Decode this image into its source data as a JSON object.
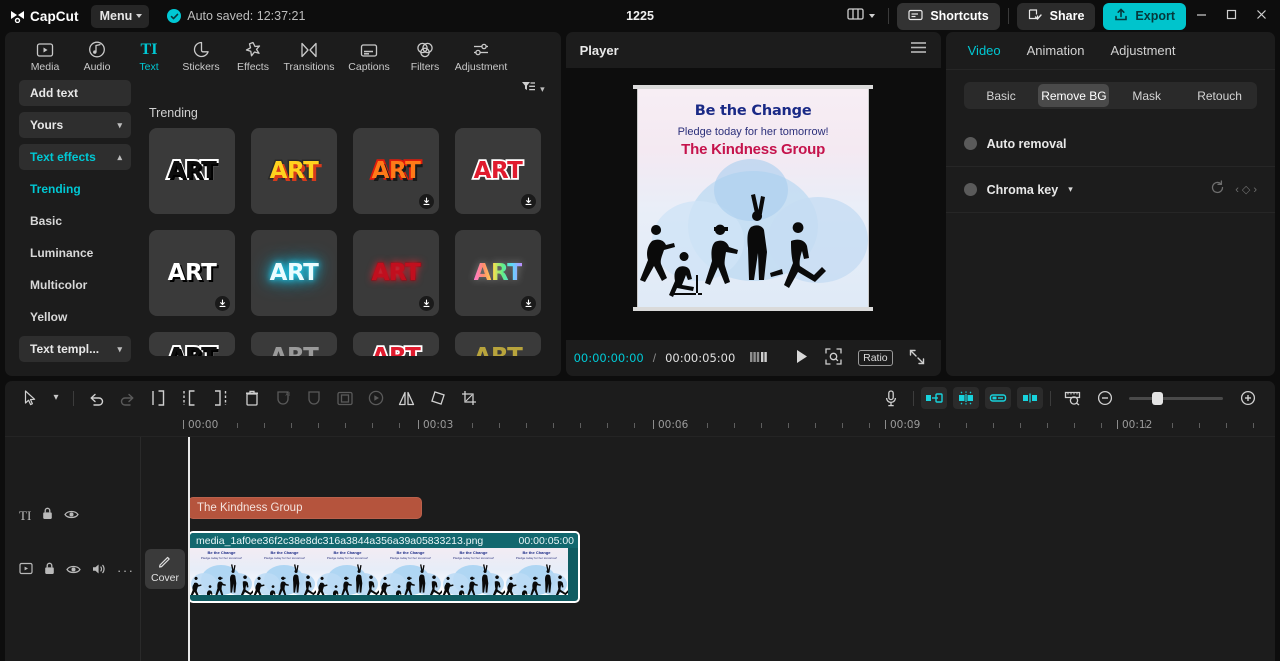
{
  "titlebar": {
    "brand": "CapCut",
    "menu_label": "Menu",
    "autosave_text": "Auto saved: 12:37:21",
    "project_title": "1225",
    "layout_icon": "layout-icon",
    "shortcuts_label": "Shortcuts",
    "share_label": "Share",
    "export_label": "Export",
    "minimize_icon": "minimize-icon",
    "maximize_icon": "maximize-icon",
    "close_icon": "close-icon",
    "accent": "#00c4cc"
  },
  "tabs": [
    {
      "label": "Media",
      "icon": "media-icon",
      "active": false
    },
    {
      "label": "Audio",
      "icon": "audio-icon",
      "active": false
    },
    {
      "label": "Text",
      "icon": "text-icon",
      "active": true
    },
    {
      "label": "Stickers",
      "icon": "stickers-icon",
      "active": false
    },
    {
      "label": "Effects",
      "icon": "effects-icon",
      "active": false
    },
    {
      "label": "Transitions",
      "icon": "transitions-icon",
      "active": false
    },
    {
      "label": "Captions",
      "icon": "captions-icon",
      "active": false
    },
    {
      "label": "Filters",
      "icon": "filters-icon",
      "active": false
    },
    {
      "label": "Adjustment",
      "icon": "adjustment-icon",
      "active": false
    }
  ],
  "sidebar": {
    "add_text": "Add text",
    "yours": "Yours",
    "text_effects": "Text effects",
    "sub_items": [
      {
        "label": "Trending",
        "selected": true
      },
      {
        "label": "Basic",
        "selected": false
      },
      {
        "label": "Luminance",
        "selected": false
      },
      {
        "label": "Multicolor",
        "selected": false
      },
      {
        "label": "Yellow",
        "selected": false
      }
    ],
    "text_templates": "Text templ..."
  },
  "effects_panel": {
    "filter_icon": "filter-sort-icon",
    "section_title": "Trending",
    "thumbs": [
      {
        "label": "ART",
        "style": "art-1",
        "download": false
      },
      {
        "label": "ART",
        "style": "art-2",
        "download": false
      },
      {
        "label": "ART",
        "style": "art-3",
        "download": true
      },
      {
        "label": "ART",
        "style": "art-4",
        "download": true
      },
      {
        "label": "ART",
        "style": "art-5",
        "download": true
      },
      {
        "label": "ART",
        "style": "art-6",
        "download": false
      },
      {
        "label": "ART",
        "style": "art-7",
        "download": true
      },
      {
        "label": "ART",
        "style": "art-8",
        "download": true
      }
    ]
  },
  "player": {
    "title": "Player",
    "menu_icon": "hamburger-icon",
    "canvas": {
      "headline": "Be the Change",
      "subline": "Pledge today for her tomorrow!",
      "brand": "The Kindness Group"
    },
    "current_time": "00:00:00:00",
    "separator": "/",
    "total_time": "00:00:05:00",
    "quality_icon": "quality-icon",
    "play_icon": "play-icon",
    "magnifier_icon": "zoom-fit-icon",
    "ratio_label": "Ratio",
    "fullscreen_icon": "fullscreen-icon"
  },
  "inspector": {
    "tabs": [
      {
        "label": "Video",
        "active": true
      },
      {
        "label": "Animation",
        "active": false
      },
      {
        "label": "Adjustment",
        "active": false
      }
    ],
    "segments": [
      {
        "label": "Basic",
        "active": false
      },
      {
        "label": "Remove BG",
        "active": true
      },
      {
        "label": "Mask",
        "active": false
      },
      {
        "label": "Retouch",
        "active": false
      }
    ],
    "rows": [
      {
        "label": "Auto removal",
        "has_dropdown": false,
        "has_keyframe": false
      },
      {
        "label": "Chroma key",
        "has_dropdown": true,
        "has_keyframe": true
      }
    ],
    "reset_icon": "reset-icon",
    "keyframe_prev_icon": "keyframe-prev-icon",
    "keyframe_icon": "keyframe-icon",
    "keyframe_next_icon": "keyframe-next-icon"
  },
  "timeline_toolbar": {
    "left_icons": [
      {
        "name": "select-tool-icon",
        "enabled": true
      },
      {
        "name": "chevron-down-icon",
        "enabled": true
      },
      {
        "name": "undo-icon",
        "enabled": true
      },
      {
        "name": "redo-icon",
        "enabled": false
      },
      {
        "name": "split-icon",
        "enabled": true
      },
      {
        "name": "trim-left-icon",
        "enabled": true
      },
      {
        "name": "trim-right-icon",
        "enabled": true
      },
      {
        "name": "delete-icon",
        "enabled": true
      },
      {
        "name": "ai-mask-icon",
        "enabled": false
      },
      {
        "name": "mask-icon",
        "enabled": false
      },
      {
        "name": "crop-frame-icon",
        "enabled": false
      },
      {
        "name": "freeze-icon",
        "enabled": false
      },
      {
        "name": "mirror-icon",
        "enabled": true
      },
      {
        "name": "rotate-icon",
        "enabled": true
      },
      {
        "name": "crop-icon",
        "enabled": true
      }
    ],
    "right_icons": [
      {
        "name": "microphone-icon",
        "active": false
      },
      {
        "name": "auto-snap-icon",
        "active": true
      },
      {
        "name": "magnet-snap-icon",
        "active": true
      },
      {
        "name": "link-icon",
        "active": true
      },
      {
        "name": "adsorption-icon",
        "active": true
      },
      {
        "name": "timeline-preview-icon",
        "active": false
      },
      {
        "name": "zoom-out-icon",
        "active": false
      },
      {
        "name": "zoom-in-icon",
        "active": false
      }
    ]
  },
  "ruler": {
    "labels": [
      "00:00",
      "00:03",
      "00:06",
      "00:09",
      "00:12"
    ]
  },
  "tracks": {
    "text_track": {
      "icon": "text-track-icon",
      "lock_icon": "lock-icon",
      "eye_icon": "eye-icon",
      "clip_label": "The Kindness Group"
    },
    "video_track": {
      "icon": "video-track-icon",
      "lock_icon": "lock-icon",
      "eye_icon": "eye-icon",
      "volume_icon": "volume-icon",
      "more_icon": "more-icon",
      "cover_label": "Cover",
      "cover_icon": "edit-pencil-icon",
      "clip_label": "media_1af0ee36f2c38e8dc316a3844a356a39a05833213.png",
      "clip_duration": "00:00:05:00"
    }
  }
}
